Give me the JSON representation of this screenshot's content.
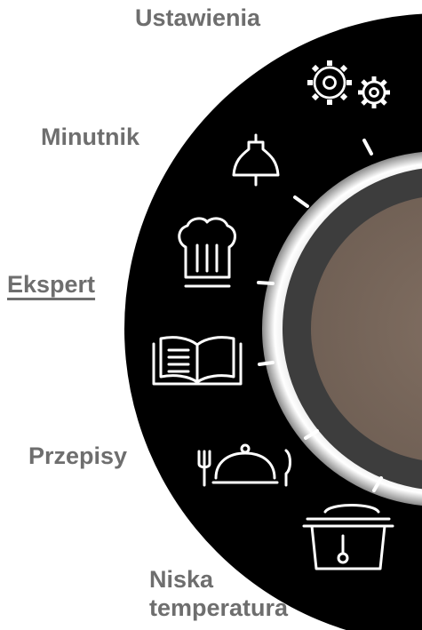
{
  "menu": {
    "items": [
      {
        "id": "ustawienia",
        "label": "Ustawienia",
        "icon": "gears-icon",
        "selected": false
      },
      {
        "id": "minutnik",
        "label": "Minutnik",
        "icon": "bell-icon",
        "selected": false
      },
      {
        "id": "ekspert",
        "label": "Ekspert",
        "icon": "chef-hat-icon",
        "selected": true
      },
      {
        "id": "przepisy_book",
        "label": "",
        "icon": "recipe-book-icon",
        "selected": false
      },
      {
        "id": "przepisy",
        "label": "Przepisy",
        "icon": "cloche-cutlery-icon",
        "selected": false
      },
      {
        "id": "niska",
        "label_line1": "Niska",
        "label_line2": "temperatura",
        "icon": "pot-thermometer-icon",
        "selected": false
      }
    ]
  },
  "colors": {
    "ring": "#000000",
    "knob_center": "#7b6a5e",
    "knob_rim": "#c8c8c8",
    "label_text": "#6e6e6e",
    "icon_stroke": "#ffffff"
  }
}
